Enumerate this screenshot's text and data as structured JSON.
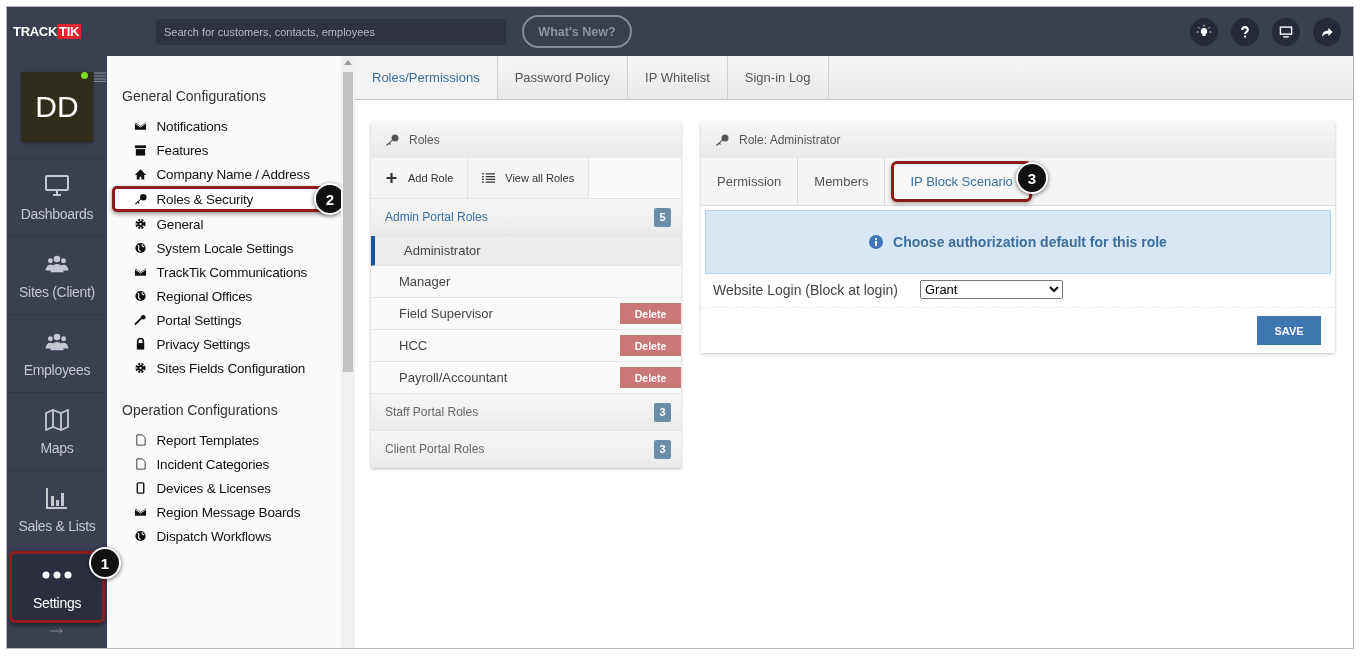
{
  "header": {
    "logo": {
      "first": "TRACK",
      "second": "TIK"
    },
    "search": {
      "placeholder": "Search for customers, contacts, employees"
    },
    "whats_new": "What's New?"
  },
  "nav": {
    "avatar": {
      "initials": "DD",
      "online": true
    },
    "items": [
      {
        "label": "Dashboards",
        "selected": false
      },
      {
        "label": "Sites (Client)",
        "selected": false
      },
      {
        "label": "Employees",
        "selected": false
      },
      {
        "label": "Maps",
        "selected": false
      },
      {
        "label": "Sales & Lists",
        "selected": false
      },
      {
        "label": "Settings",
        "selected": true,
        "callout": "1"
      }
    ]
  },
  "settings_menu": [
    {
      "title": "General Configurations",
      "items": [
        {
          "label": "Notifications",
          "selected": false
        },
        {
          "label": "Features",
          "selected": false
        },
        {
          "label": "Company Name / Address",
          "selected": false
        },
        {
          "label": "Roles & Security",
          "selected": true,
          "callout": "2"
        },
        {
          "label": "General",
          "selected": false
        },
        {
          "label": "System Locale Settings",
          "selected": false
        },
        {
          "label": "TrackTik Communications",
          "selected": false
        },
        {
          "label": "Regional Offices",
          "selected": false
        },
        {
          "label": "Portal Settings",
          "selected": false
        },
        {
          "label": "Privacy Settings",
          "selected": false
        },
        {
          "label": "Sites Fields Configuration",
          "selected": false
        }
      ]
    },
    {
      "title": "Operation Configurations",
      "items": [
        {
          "label": "Report Templates",
          "selected": false
        },
        {
          "label": "Incident Categories",
          "selected": false
        },
        {
          "label": "Devices & Licenses",
          "selected": false
        },
        {
          "label": "Region Message Boards",
          "selected": false
        },
        {
          "label": "Dispatch Workflows",
          "selected": false
        }
      ]
    }
  ],
  "tabs": [
    {
      "label": "Roles/Permissions",
      "selected": true
    },
    {
      "label": "Password Policy",
      "selected": false
    },
    {
      "label": "IP Whitelist",
      "selected": false
    },
    {
      "label": "Sign-in Log",
      "selected": false
    }
  ],
  "roles_panel": {
    "title": "Roles",
    "actions": [
      "Add Role",
      "View all Roles"
    ],
    "groups": [
      {
        "title": "Admin Portal Roles",
        "count": "5",
        "expanded": true,
        "roles": [
          {
            "name": "Administrator",
            "selected": true
          },
          {
            "name": "Manager",
            "selected": false
          },
          {
            "name": "Field Supervisor",
            "selected": false,
            "delete": "Delete"
          },
          {
            "name": "HCC",
            "selected": false,
            "delete": "Delete"
          },
          {
            "name": "Payroll/Accountant",
            "selected": false,
            "delete": "Delete"
          }
        ]
      },
      {
        "title": "Staff Portal Roles",
        "count": "3",
        "expanded": false
      },
      {
        "title": "Client Portal Roles",
        "count": "3",
        "expanded": false
      }
    ]
  },
  "role_panel": {
    "title": "Role: Administrator",
    "tabs": [
      {
        "label": "Permission",
        "selected": false
      },
      {
        "label": "Members",
        "selected": false
      },
      {
        "label": "IP Block Scenario",
        "selected": true,
        "callout": "3"
      }
    ],
    "info": "Choose authorization default for this role",
    "field": {
      "label": "Website Login (Block at login)",
      "value": "Grant"
    },
    "save": "SAVE"
  }
}
